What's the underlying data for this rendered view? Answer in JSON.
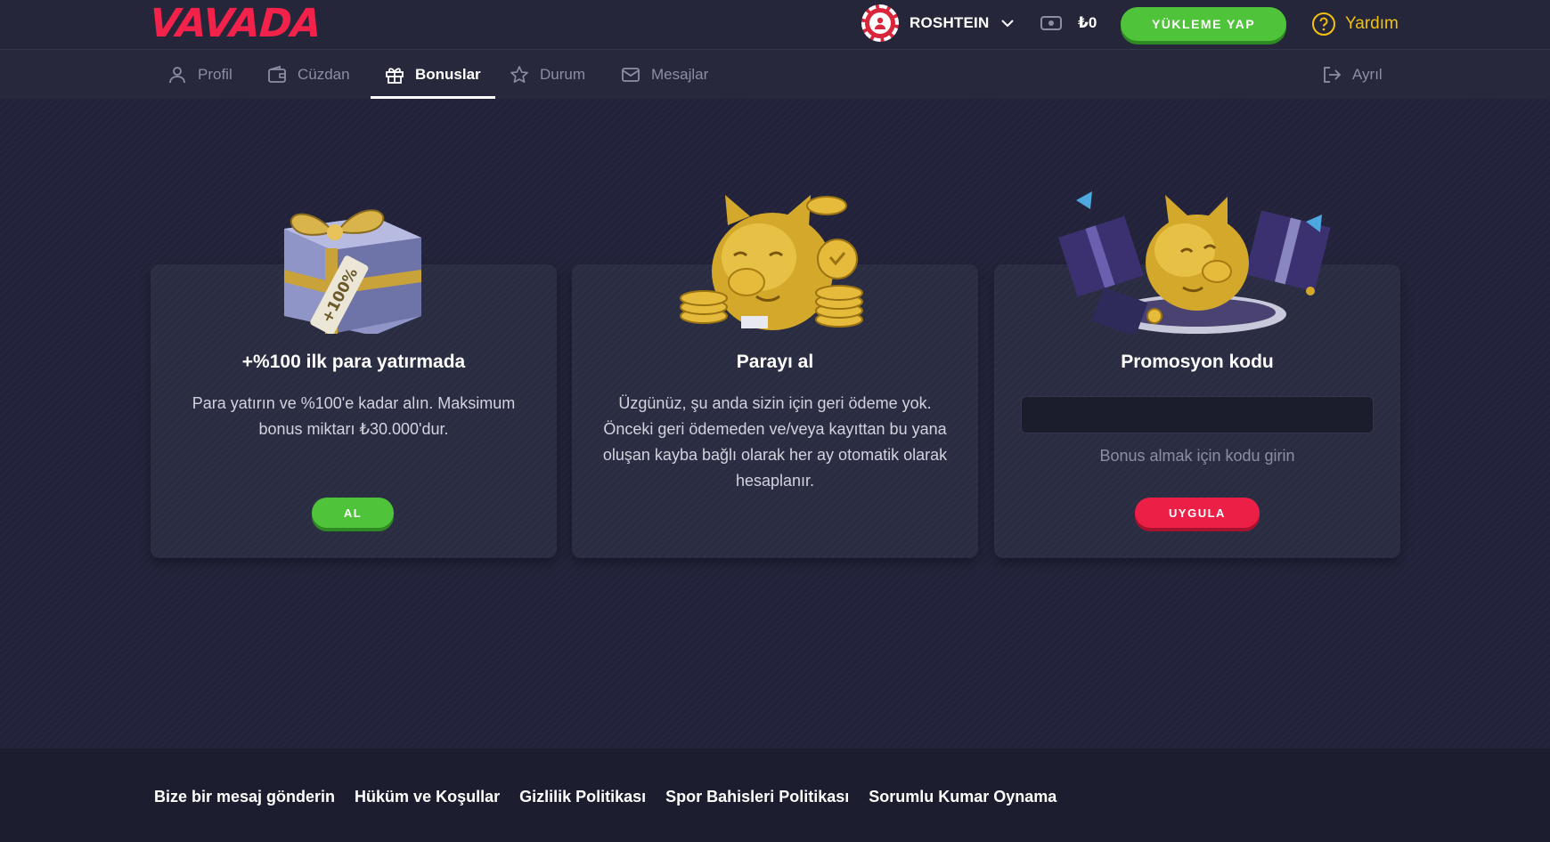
{
  "brand": {
    "logo_text": "VAVADA",
    "logo_color": "#f2224b"
  },
  "header": {
    "username": "ROSHTEIN",
    "balance": "₺0",
    "deposit_label": "YÜKLEME YAP",
    "help_label": "Yardım",
    "accent_green": "#4fc43a",
    "help_color": "#f4c20d"
  },
  "nav": {
    "tabs": [
      {
        "label": "Profil",
        "icon": "user-icon"
      },
      {
        "label": "Cüzdan",
        "icon": "wallet-icon"
      },
      {
        "label": "Bonuslar",
        "icon": "gift-icon",
        "active": true
      },
      {
        "label": "Durum",
        "icon": "star-icon"
      },
      {
        "label": "Mesajlar",
        "icon": "mail-icon"
      }
    ],
    "logout_label": "Ayrıl"
  },
  "cards": [
    {
      "title": "+%100 ilk para yatırmada",
      "text": "Para yatırın ve %100'e kadar alın. Maksimum bonus miktarı ₺30.000'dur.",
      "button": "AL",
      "image": "gift-box-icon",
      "tag_text": "+100%"
    },
    {
      "title": "Parayı al",
      "text": "Üzgünüz, şu anda sizin için geri ödeme yok. Önceki geri ödemeden ve/veya kayıttan bu yana oluşan kayba bağlı olarak her ay otomatik olarak hesaplanır.",
      "image": "piggy-bank-coins-icon"
    },
    {
      "title": "Promosyon kodu",
      "input_value": "",
      "hint": "Bonus almak için kodu girin",
      "button": "UYGULA",
      "image": "piggy-bank-gifts-icon",
      "button_color": "#ec1f47"
    }
  ],
  "footer": {
    "links": [
      "Bize bir mesaj gönderin",
      "Hüküm ve Koşullar",
      "Gizlilik Politikası",
      "Spor Bahisleri Politikası",
      "Sorumlu Kumar Oynama"
    ]
  }
}
